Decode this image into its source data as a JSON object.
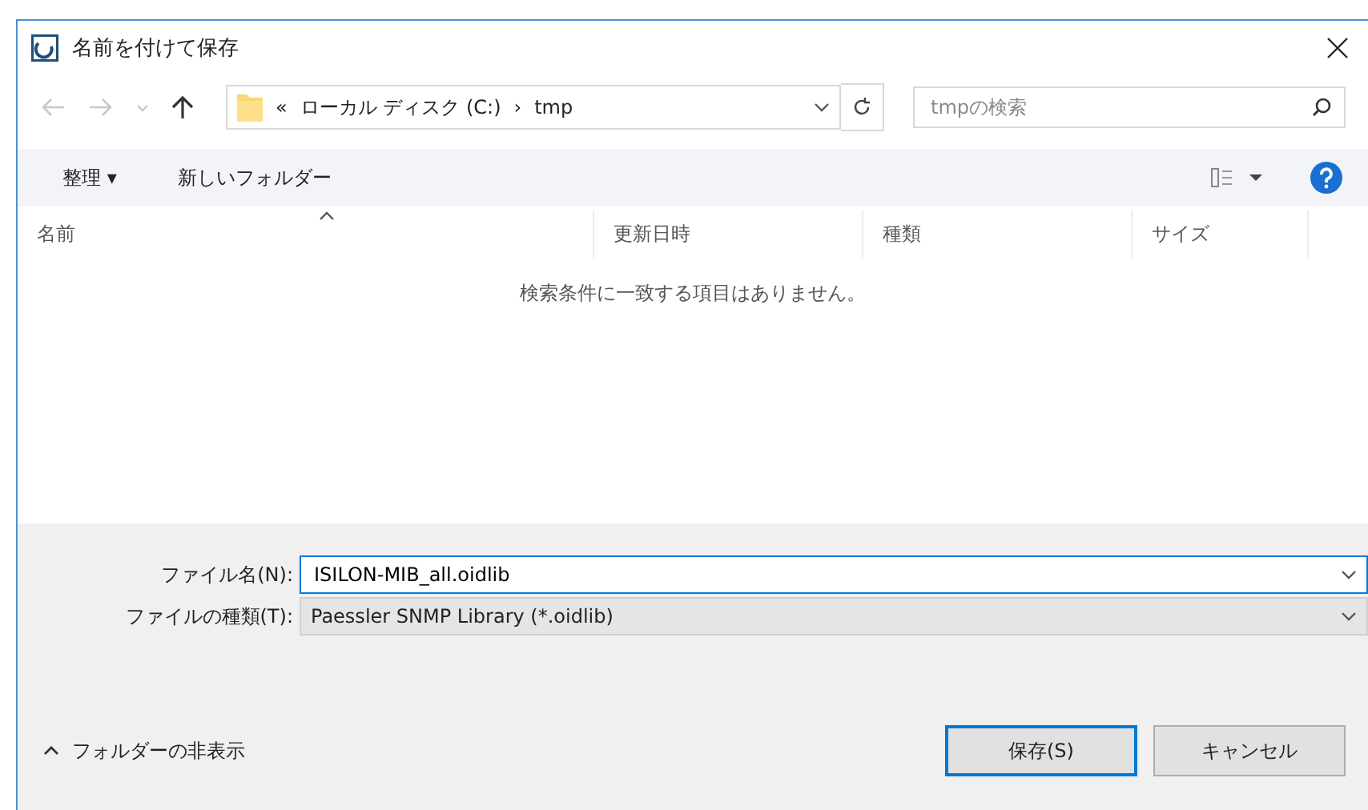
{
  "window": {
    "title": "名前を付けて保存"
  },
  "nav_buttons": [
    {
      "kind": "back",
      "disabled": true
    },
    {
      "kind": "forward",
      "disabled": true
    },
    {
      "kind": "recent",
      "disabled": true
    },
    {
      "kind": "up",
      "disabled": false
    }
  ],
  "breadcrumb": [
    "«",
    "ローカル ディスク (C:)",
    "›",
    "tmp"
  ],
  "search": {
    "placeholder": "tmpの検索"
  },
  "toolbar": {
    "organize": "整理 ▾",
    "new_folder": "新しいフォルダー"
  },
  "columns": [
    {
      "label": "名前",
      "sorted": true
    },
    {
      "label": "更新日時",
      "sorted": false
    },
    {
      "label": "種類",
      "sorted": false
    },
    {
      "label": "サイズ",
      "sorted": false
    }
  ],
  "empty_message": "検索条件に一致する項目はありません。",
  "file_name": {
    "label": "ファイル名(N):",
    "value": "ISILON-MIB_all.oidlib"
  },
  "file_type": {
    "label": "ファイルの種類(T):",
    "value": "Paessler SNMP Library (*.oidlib)"
  },
  "hide_folders": "フォルダーの非表示",
  "buttons": [
    {
      "label": "保存(S)",
      "default": true
    },
    {
      "label": "キャンセル",
      "default": false
    }
  ]
}
